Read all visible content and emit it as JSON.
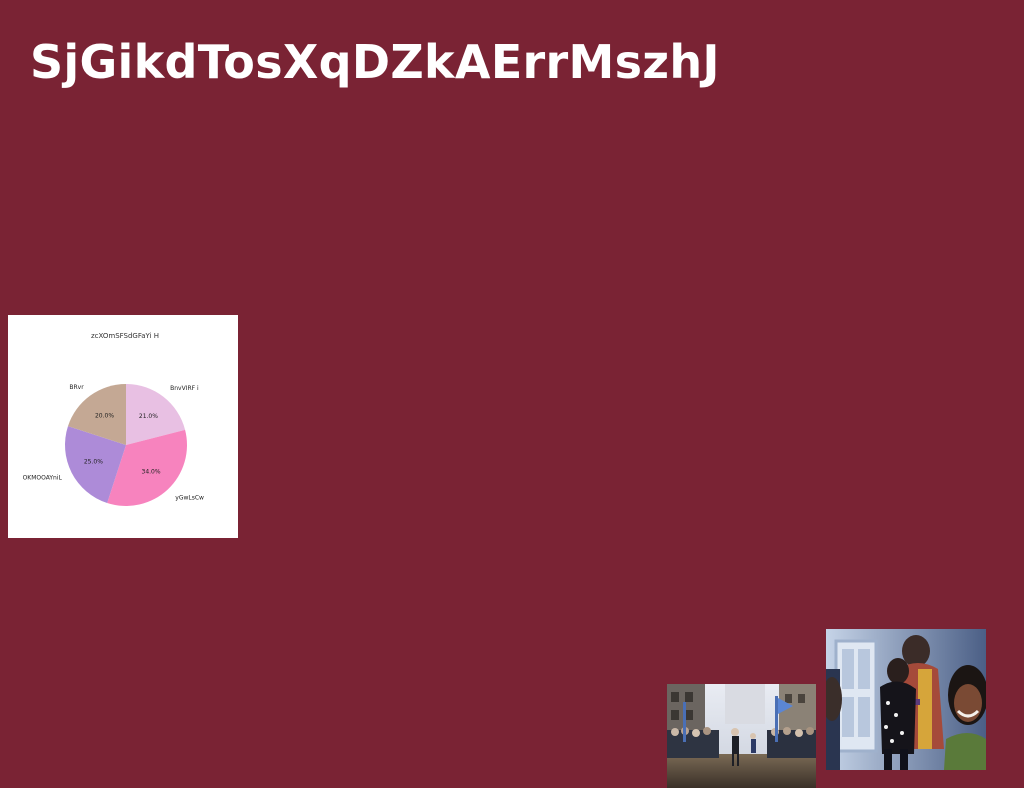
{
  "page": {
    "title": "SjGikdTosXqDZkAErrMszhJ"
  },
  "colors": {
    "background": "#7a2334",
    "card_background": "#ffffff",
    "title_text": "#ffffff"
  },
  "chart_data": {
    "type": "pie",
    "title": "zcXOmSFSdGFaYi H",
    "start_angle_deg": 90,
    "direction": "clockwise",
    "slices": [
      {
        "label": "BnvVIRF i",
        "value": 21.0,
        "pct_label": "21.0%",
        "color": "#e8c0e3"
      },
      {
        "label": "yGwLsCw",
        "value": 34.0,
        "pct_label": "34.0%",
        "color": "#f783be"
      },
      {
        "label": "OKMOOAYniL",
        "value": 25.0,
        "pct_label": "25.0%",
        "color": "#ad8bd8"
      },
      {
        "label": "BRvr",
        "value": 20.0,
        "pct_label": "20.0%",
        "color": "#c4a894"
      }
    ]
  },
  "images": [
    {
      "name": "parade-photo",
      "description_icon": "street-parade-photo"
    },
    {
      "name": "hug-photo",
      "description_icon": "people-hugging-photo"
    }
  ]
}
